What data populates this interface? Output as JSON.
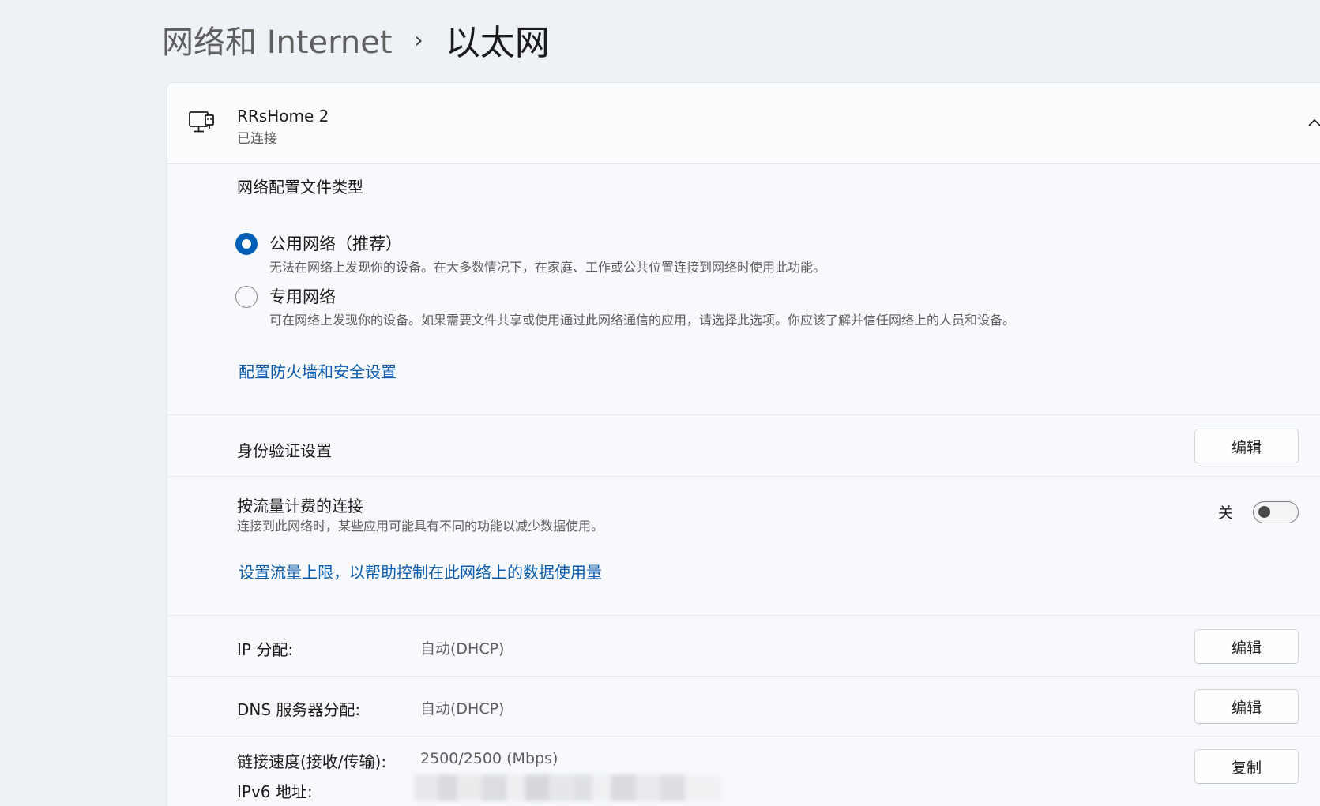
{
  "breadcrumb": {
    "parent": "网络和 Internet",
    "separator": "›",
    "current": "以太网"
  },
  "network": {
    "icon": "ethernet-icon",
    "name": "RRsHome 2",
    "status": "已连接"
  },
  "profile": {
    "title": "网络配置文件类型",
    "options": [
      {
        "label": "公用网络（推荐）",
        "description": "无法在网络上发现你的设备。在大多数情况下，在家庭、工作或公共位置连接到网络时使用此功能。",
        "selected": true
      },
      {
        "label": "专用网络",
        "description": "可在网络上发现你的设备。如果需要文件共享或使用通过此网络通信的应用，请选择此选项。你应该了解并信任网络上的人员和设备。",
        "selected": false
      }
    ],
    "firewall_link": "配置防火墙和安全设置"
  },
  "auth": {
    "label": "身份验证设置",
    "button": "编辑"
  },
  "metered": {
    "label": "按流量计费的连接",
    "description": "连接到此网络时，某些应用可能具有不同的功能以减少数据使用。",
    "toggle_label": "关",
    "toggle_on": false,
    "limit_link": "设置流量上限，以帮助控制在此网络上的数据使用量"
  },
  "ip": {
    "label": "IP 分配:",
    "value": "自动(DHCP)",
    "button": "编辑"
  },
  "dns": {
    "label": "DNS 服务器分配:",
    "value": "自动(DHCP)",
    "button": "编辑"
  },
  "link_speed": {
    "label": "链接速度(接收/传输):",
    "value": "2500/2500 (Mbps)",
    "button": "复制"
  },
  "ipv6": {
    "label": "IPv6 地址:"
  },
  "colors": {
    "accent": "#005fb8",
    "link": "#0b5cad",
    "background": "#eef2f7",
    "card": "#f7f9fc"
  }
}
